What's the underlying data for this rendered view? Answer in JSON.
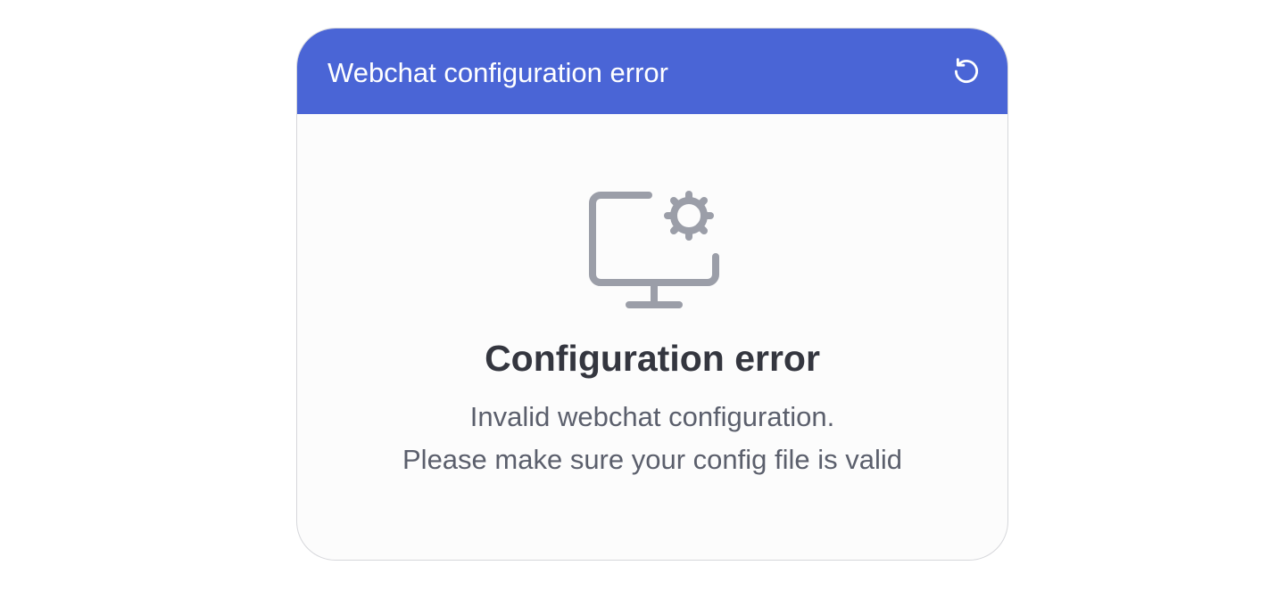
{
  "header": {
    "title": "Webchat configuration error",
    "background_color": "#4a65d6",
    "reload_icon": "reload-icon"
  },
  "error": {
    "icon": "monitor-settings-icon",
    "title": "Configuration error",
    "message_line1": "Invalid webchat configuration.",
    "message_line2": "Please make sure your config file is valid"
  }
}
